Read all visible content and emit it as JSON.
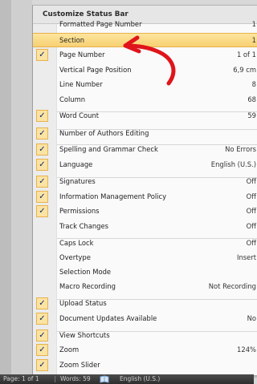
{
  "menu": {
    "title": "Customize Status Bar",
    "items": [
      {
        "label": "Formatted Page Number",
        "value": "1",
        "checked": false
      },
      {
        "label": "Section",
        "value": "1",
        "checked": false,
        "highlighted": true
      },
      {
        "label": "Page Number",
        "value": "1 of 1",
        "checked": true
      },
      {
        "label": "Vertical Page Position",
        "value": "6,9 cm",
        "checked": false
      },
      {
        "label": "Line Number",
        "value": "8",
        "checked": false
      },
      {
        "label": "Column",
        "value": "68",
        "checked": false
      },
      {
        "label": "Word Count",
        "value": "59",
        "checked": true
      },
      {
        "label": "Number of Authors Editing",
        "value": "",
        "checked": true
      },
      {
        "label": "Spelling and Grammar Check",
        "value": "No Errors",
        "checked": true
      },
      {
        "label": "Language",
        "value": "English (U.S.)",
        "checked": true
      },
      {
        "label": "Signatures",
        "value": "Off",
        "checked": true
      },
      {
        "label": "Information Management Policy",
        "value": "Off",
        "checked": true
      },
      {
        "label": "Permissions",
        "value": "Off",
        "checked": true
      },
      {
        "label": "Track Changes",
        "value": "Off",
        "checked": false
      },
      {
        "label": "Caps Lock",
        "value": "Off",
        "checked": false
      },
      {
        "label": "Overtype",
        "value": "Insert",
        "checked": false
      },
      {
        "label": "Selection Mode",
        "value": "",
        "checked": false
      },
      {
        "label": "Macro Recording",
        "value": "Not Recording",
        "checked": false
      },
      {
        "label": "Upload Status",
        "value": "",
        "checked": true
      },
      {
        "label": "Document Updates Available",
        "value": "No",
        "checked": true
      },
      {
        "label": "View Shortcuts",
        "value": "",
        "checked": true
      },
      {
        "label": "Zoom",
        "value": "124%",
        "checked": true
      },
      {
        "label": "Zoom Slider",
        "value": "",
        "checked": true
      }
    ]
  },
  "status_bar": {
    "page": "Page: 1 of 1",
    "words": "Words: 59",
    "proofing_icon": "proofing-book-icon",
    "language": "English (U.S.)"
  },
  "colors": {
    "highlight": "#f7d072",
    "check": "#0d2a66",
    "arrow": "#e0141b",
    "status_bar": "#3a3a3a"
  },
  "check_glyph": "✓"
}
